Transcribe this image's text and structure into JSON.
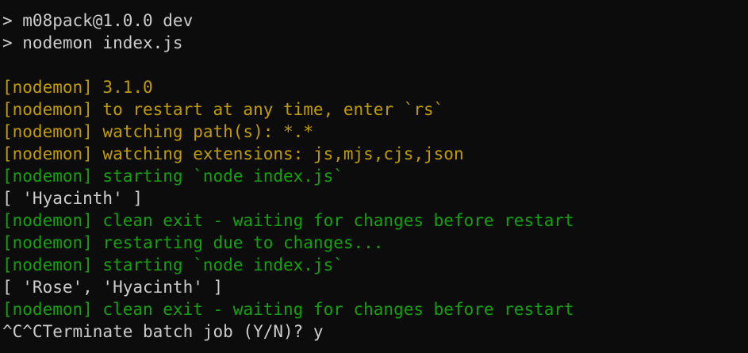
{
  "terminal": {
    "lines": [
      {
        "text": "> m08pack@1.0.0 dev",
        "color": "#cccccc"
      },
      {
        "text": "> nodemon index.js",
        "color": "#cccccc"
      },
      {
        "text": "",
        "color": "#cccccc"
      },
      {
        "text": "[nodemon] 3.1.0",
        "color": "#c19c00"
      },
      {
        "text": "[nodemon] to restart at any time, enter `rs`",
        "color": "#c19c00"
      },
      {
        "text": "[nodemon] watching path(s): *.*",
        "color": "#c19c00"
      },
      {
        "text": "[nodemon] watching extensions: js,mjs,cjs,json",
        "color": "#c19c00"
      },
      {
        "text": "[nodemon] starting `node index.js`",
        "color": "#13a10e"
      },
      {
        "text": "[ 'Hyacinth' ]",
        "color": "#cccccc"
      },
      {
        "text": "[nodemon] clean exit - waiting for changes before restart",
        "color": "#13a10e"
      },
      {
        "text": "[nodemon] restarting due to changes...",
        "color": "#13a10e"
      },
      {
        "text": "[nodemon] starting `node index.js`",
        "color": "#13a10e"
      },
      {
        "text": "[ 'Rose', 'Hyacinth' ]",
        "color": "#cccccc"
      },
      {
        "text": "[nodemon] clean exit - waiting for changes before restart",
        "color": "#13a10e"
      },
      {
        "text": "^C^CTerminate batch job (Y/N)? y",
        "color": "#cccccc"
      }
    ],
    "background": "#0c0c0c"
  }
}
